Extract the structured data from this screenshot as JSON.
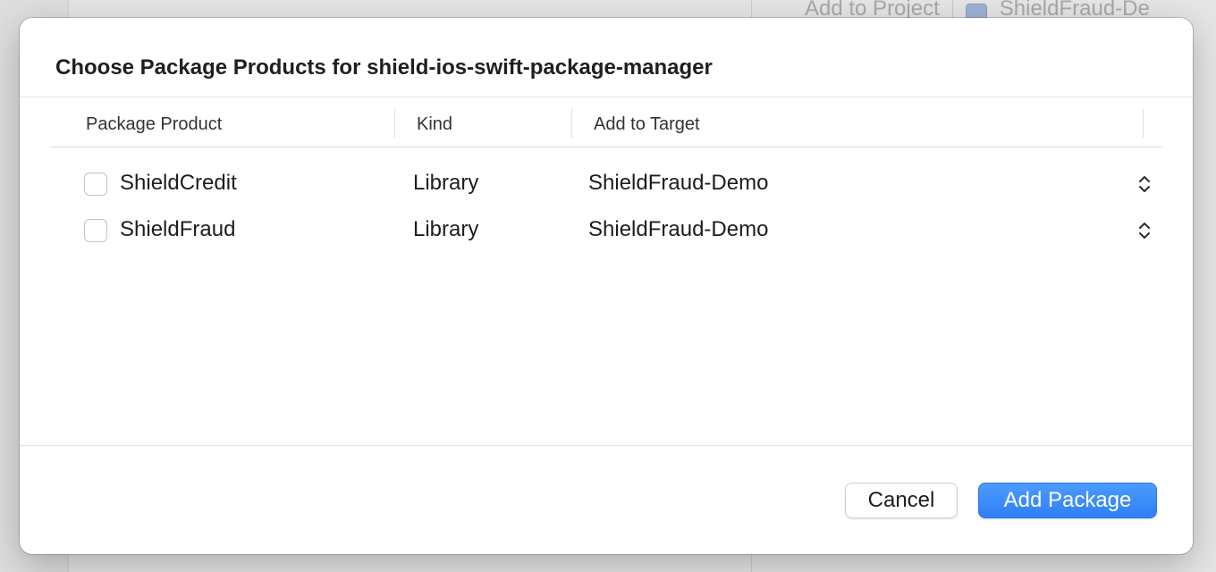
{
  "background": {
    "toolbar_add_to_project": "Add to Project",
    "toolbar_target": "ShieldFraud-De"
  },
  "dialog": {
    "title": "Choose Package Products for shield-ios-swift-package-manager",
    "columns": [
      "Package Product",
      "Kind",
      "Add to Target"
    ],
    "rows": [
      {
        "product": "ShieldCredit",
        "kind": "Library",
        "target": "ShieldFraud-Demo",
        "checked": false
      },
      {
        "product": "ShieldFraud",
        "kind": "Library",
        "target": "ShieldFraud-Demo",
        "checked": false
      }
    ],
    "cancel_label": "Cancel",
    "add_label": "Add Package"
  },
  "colors": {
    "accent": "#2f7ff5",
    "sheet_background": "#ffffff"
  },
  "icons": {
    "stepper": "chevron-up-down-icon",
    "target_app": "app-icon"
  }
}
